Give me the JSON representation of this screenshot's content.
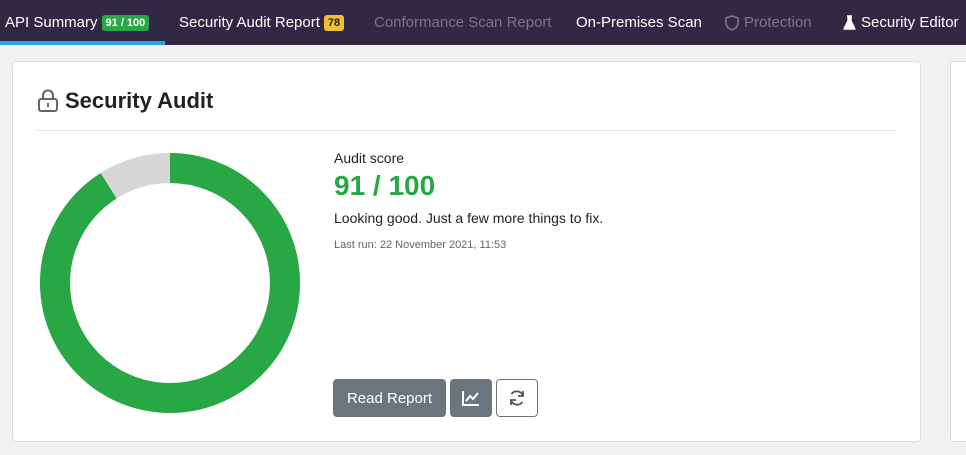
{
  "nav": {
    "tabs": [
      {
        "label": "API Summary",
        "badge": "91 / 100",
        "active": true
      },
      {
        "label": "Security Audit Report",
        "badge": "78"
      },
      {
        "label": "Conformance Scan Report",
        "disabled": true
      },
      {
        "label": "On-Premises Scan"
      },
      {
        "label": "Protection",
        "disabled": true,
        "icon": "shield-icon"
      },
      {
        "label": "Security Editor",
        "icon": "flask-icon"
      }
    ]
  },
  "card": {
    "title": "Security Audit",
    "icon": "lock-icon",
    "score_label": "Audit score",
    "score_value": "91 / 100",
    "message": "Looking good. Just a few more things to fix.",
    "last_run": "Last run: 22 November 2021, 11:53",
    "score_fraction": 0.91,
    "buttons": {
      "read_report": "Read Report",
      "chart_icon": "chart-icon",
      "refresh_icon": "refresh-icon"
    }
  },
  "colors": {
    "nav_bg": "#312844",
    "accent_blue": "#2f9fe8",
    "score_green": "#28a745",
    "badge_yellow": "#f2c12e",
    "button_gray": "#6c757d"
  }
}
